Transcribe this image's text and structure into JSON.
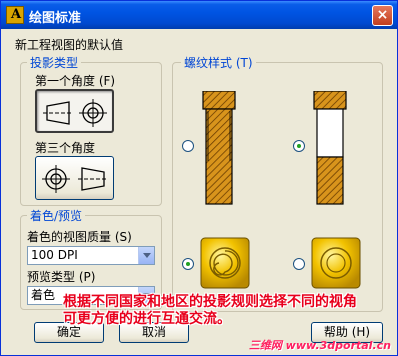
{
  "window": {
    "title": "绘图标准",
    "close_glyph": "×"
  },
  "defaults_label": "新工程视图的默认值",
  "projection": {
    "legend": "投影类型",
    "first_angle_label": "第一个角度 (F)",
    "third_angle_label": "第三个角度",
    "selected": "first_angle"
  },
  "shading": {
    "legend": "着色/预览",
    "quality_label": "着色的视图质量 (S)",
    "quality_value": "100 DPI",
    "preview_label": "预览类型 (P)",
    "preview_value": "着色"
  },
  "thread": {
    "legend": "螺纹样式 (T)",
    "selected": "top-right"
  },
  "buttons": {
    "ok": "确定",
    "cancel": "取消",
    "help": "帮助 (H)"
  },
  "annotation": "根据不同国家和地区的投影规则选择不同的视角可更方便的进行互通交流。",
  "watermark": "三维网 www.3dportal.cn",
  "colors": {
    "accent": "#0046d5",
    "thread_fill": "#d8941c",
    "shaded_fill": "#f2c200",
    "annotation": "#e8001c"
  }
}
